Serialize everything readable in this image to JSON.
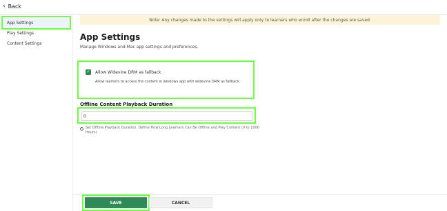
{
  "topbar": {
    "back_label": "Back"
  },
  "sidebar": {
    "items": [
      {
        "label": "App Settings"
      },
      {
        "label": "Play Settings"
      },
      {
        "label": "Content Settings"
      }
    ]
  },
  "notice": {
    "text": "Note: Any changes made to the settings will apply only to learners who enroll after the changes are saved."
  },
  "main": {
    "title": "App Settings",
    "subtitle": "Manage Windows and Mac app settings and preferences.",
    "drm": {
      "checked": true,
      "label": "Allow Widevine DRM as fallback",
      "help": "Allow learners to access the content in windows app with widevine DRM as fallback."
    },
    "offline": {
      "label": "Offline Content Playback Duration",
      "value": "0",
      "hint": "Set Offline Playback Duration. Define How Long Learners Can Be Offline and Play Content (0 to 1000 Hours)"
    }
  },
  "footer": {
    "save_label": "SAVE",
    "cancel_label": "CANCEL"
  },
  "colors": {
    "accent": "#2e8b57",
    "notice_bg": "#fdf3d9",
    "highlight": "#6cff3c"
  }
}
